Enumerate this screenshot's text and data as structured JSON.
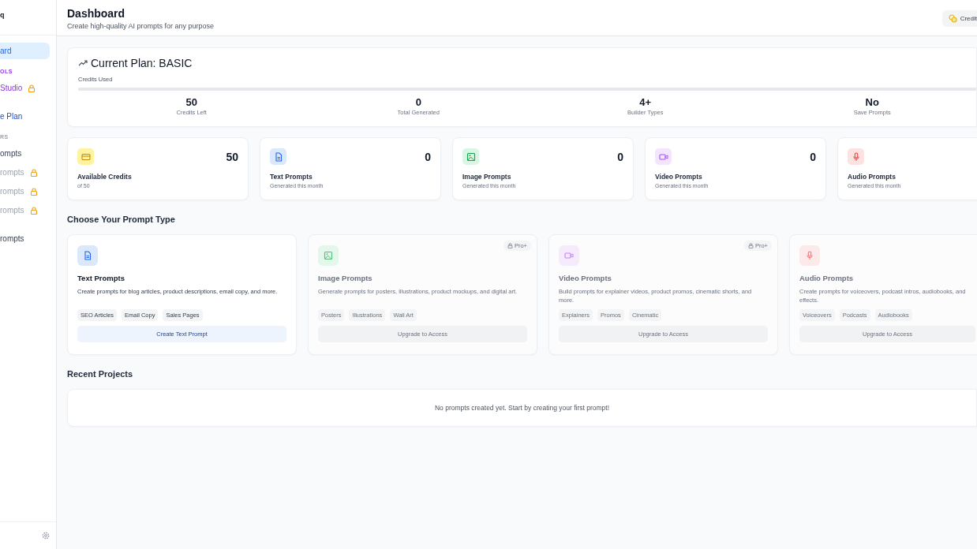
{
  "sidebar": {
    "logo": "q",
    "items": [
      {
        "kind": "nav",
        "label": "ard",
        "selected": true,
        "locked": false
      },
      {
        "kind": "heading",
        "label": "OLS"
      },
      {
        "kind": "tool",
        "label": "Studio",
        "selected": false,
        "locked": true
      },
      {
        "kind": "gap"
      },
      {
        "kind": "upgrade",
        "label": "e Plan",
        "selected": false,
        "locked": false
      },
      {
        "kind": "section",
        "label": "RS"
      },
      {
        "kind": "nav",
        "label": "ompts",
        "selected": false,
        "locked": false
      },
      {
        "kind": "pro",
        "label": "rompts",
        "selected": false,
        "locked": true
      },
      {
        "kind": "pro",
        "label": "rompts",
        "selected": false,
        "locked": true
      },
      {
        "kind": "pro",
        "label": "rompts",
        "selected": false,
        "locked": true
      },
      {
        "kind": "gap"
      },
      {
        "kind": "nav",
        "label": "rompts",
        "selected": false,
        "locked": false
      }
    ]
  },
  "header": {
    "title": "Dashboard",
    "subtitle": "Create high-quality AI prompts for any purpose",
    "credits_button": "Credit"
  },
  "plan": {
    "title": "Current Plan: BASIC",
    "usage_label": "Credits Used",
    "level": 0,
    "stats": [
      {
        "value": "50",
        "label": "Credits Left"
      },
      {
        "value": "0",
        "label": "Total Generated"
      },
      {
        "value": "4+",
        "label": "Builder Types"
      },
      {
        "value": "No",
        "label": "Save Prompts"
      }
    ]
  },
  "stat_cards": [
    {
      "kind": "credits",
      "value": "50",
      "title": "Available Credits",
      "subtitle": "of 50"
    },
    {
      "kind": "text",
      "value": "0",
      "title": "Text Prompts",
      "subtitle": "Generated this month"
    },
    {
      "kind": "image",
      "value": "0",
      "title": "Image Prompts",
      "subtitle": "Generated this month"
    },
    {
      "kind": "video",
      "value": "0",
      "title": "Video Prompts",
      "subtitle": "Generated this month"
    },
    {
      "kind": "audio",
      "title": "Audio Prompts",
      "subtitle": "Generated this month"
    }
  ],
  "prompt_types": {
    "heading": "Choose Your Prompt Type",
    "cards": [
      {
        "kind": "text",
        "locked": false,
        "title": "Text Prompts",
        "description": "Create prompts for blog articles, product descriptions, email copy, and more.",
        "tags": [
          "SEO Articles",
          "Email Copy",
          "Sales Pages"
        ],
        "action": "Create Text Prompt"
      },
      {
        "kind": "image",
        "locked": true,
        "badge": "Pro+",
        "title": "Image Prompts",
        "description": "Generate prompts for posters, illustrations, product mockups, and digital art.",
        "tags": [
          "Posters",
          "Illustrations",
          "Wall Art"
        ],
        "action": "Upgrade to Access"
      },
      {
        "kind": "video",
        "locked": true,
        "badge": "Pro+",
        "title": "Video Prompts",
        "description": "Build prompts for explainer videos, product promos, cinematic shorts, and more.",
        "tags": [
          "Explainers",
          "Promos",
          "Cinematic"
        ],
        "action": "Upgrade to Access"
      },
      {
        "kind": "audio",
        "locked": true,
        "title": "Audio Prompts",
        "description": "Create prompts for voiceovers, podcast intros, audiobooks, and effects.",
        "tags": [
          "Voiceovers",
          "Podcasts",
          "Audiobooks"
        ],
        "action": "Upgrade to Access"
      }
    ]
  },
  "recent": {
    "heading": "Recent Projects",
    "empty_message": "No prompts created yet. Start by creating your first prompt!"
  }
}
